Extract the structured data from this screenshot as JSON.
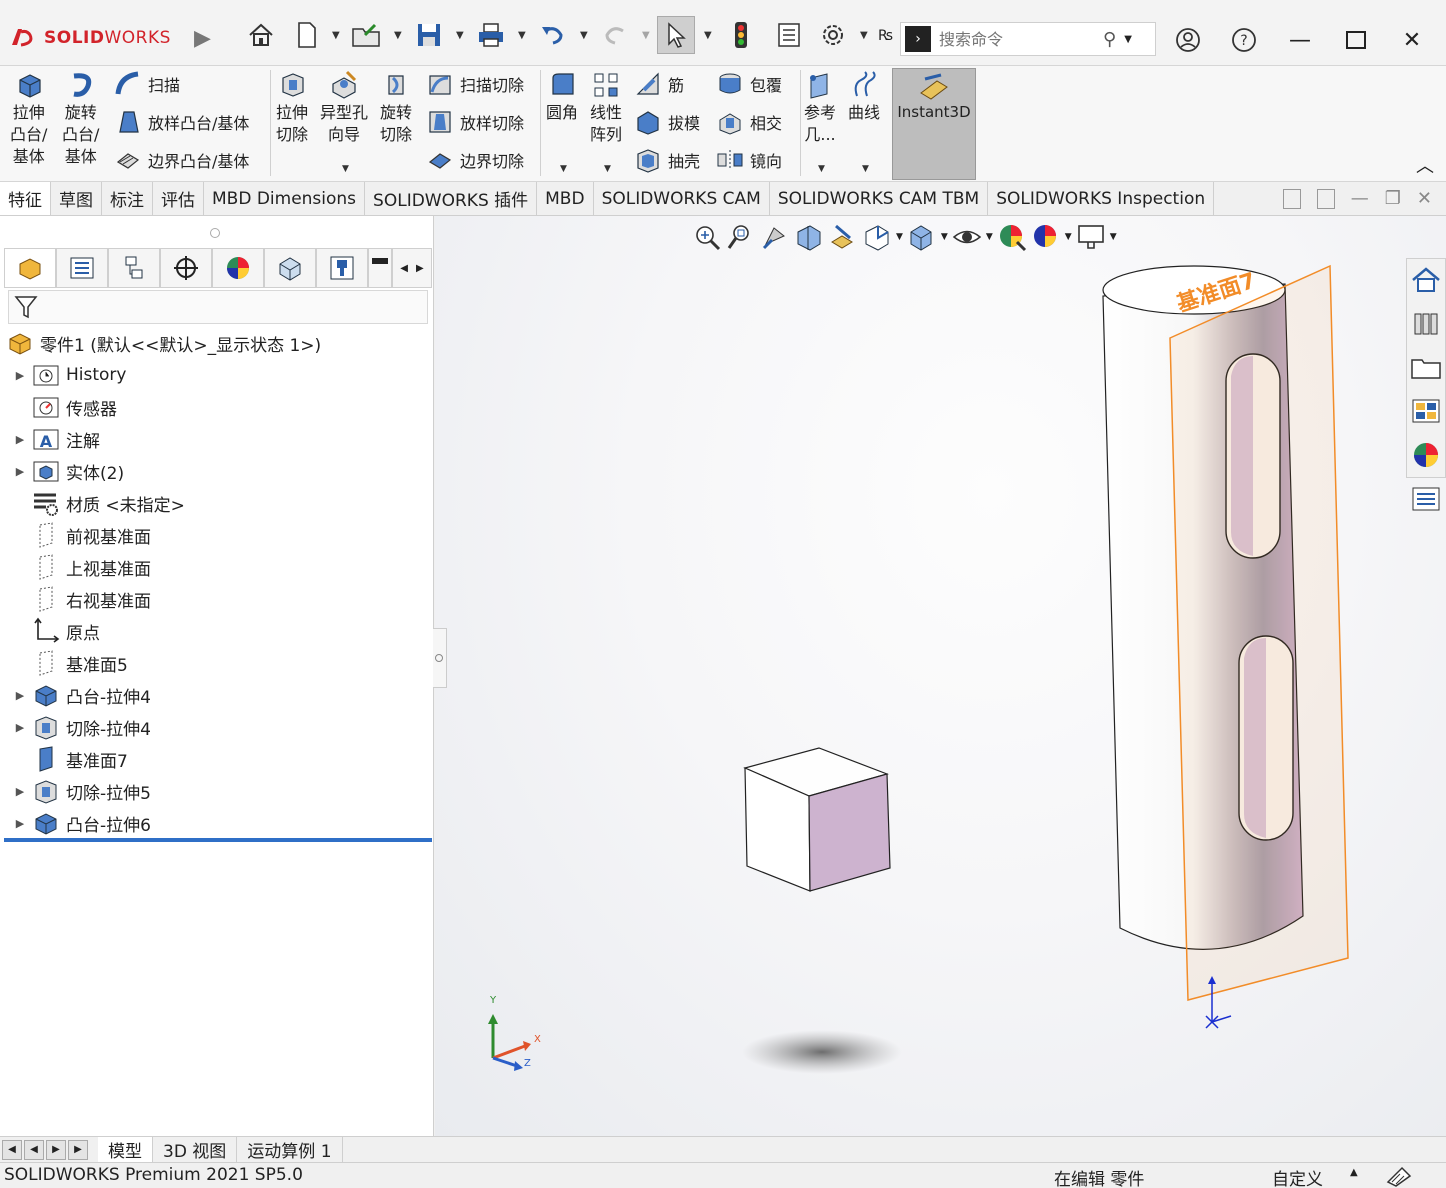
{
  "app": {
    "logo_text_a": "SOLID",
    "logo_text_b": "WORKS"
  },
  "search": {
    "placeholder": "搜索命令"
  },
  "ribbon": {
    "extrude_boss": [
      "拉伸",
      "凸台/",
      "基体"
    ],
    "revolve_boss": [
      "旋转",
      "凸台/",
      "基体"
    ],
    "sweep": "扫描",
    "loft_boss": "放样凸台/基体",
    "boundary_boss": "边界凸台/基体",
    "extrude_cut": [
      "拉伸",
      "切除"
    ],
    "hole_wizard": [
      "异型孔",
      "向导"
    ],
    "revolve_cut": [
      "旋转",
      "切除"
    ],
    "swept_cut": "扫描切除",
    "lofted_cut": "放样切除",
    "boundary_cut": "边界切除",
    "fillet": "圆角",
    "linear_pattern": [
      "线性",
      "阵列"
    ],
    "rib": "筋",
    "draft": "拔模",
    "shell": "抽壳",
    "wrap": "包覆",
    "intersect": "相交",
    "mirror": "镜向",
    "ref_geometry": [
      "参考",
      "几..."
    ],
    "curves": "曲线",
    "instant3d": "Instant3D"
  },
  "tabs": [
    "特征",
    "草图",
    "标注",
    "评估",
    "MBD Dimensions",
    "SOLIDWORKS 插件",
    "MBD",
    "SOLIDWORKS CAM",
    "SOLIDWORKS CAM TBM",
    "SOLIDWORKS Inspection"
  ],
  "tree": {
    "root": "零件1  (默认<<默认>_显示状态 1>)",
    "items": [
      {
        "label": "History"
      },
      {
        "label": "传感器"
      },
      {
        "label": "注解"
      },
      {
        "label": "实体(2)"
      },
      {
        "label": "材质 <未指定>"
      },
      {
        "label": "前视基准面"
      },
      {
        "label": "上视基准面"
      },
      {
        "label": "右视基准面"
      },
      {
        "label": "原点"
      },
      {
        "label": "基准面5"
      },
      {
        "label": "凸台-拉伸4"
      },
      {
        "label": "切除-拉伸4"
      },
      {
        "label": "基准面7"
      },
      {
        "label": "切除-拉伸5"
      },
      {
        "label": "凸台-拉伸6"
      }
    ]
  },
  "viewport": {
    "plane_label": "基准面7",
    "axis_x": "X",
    "axis_y": "Y",
    "axis_z": "Z"
  },
  "bottom_tabs": [
    "模型",
    "3D 视图",
    "运动算例 1"
  ],
  "status": {
    "product": "SOLIDWORKS Premium 2021 SP5.0",
    "mode": "在编辑 零件",
    "units": "自定义"
  },
  "colors": {
    "brand_red": "#d2232a",
    "plane_orange": "#f28c28",
    "face_pink": "#cdb3cf",
    "rollback_blue": "#2f6fc7"
  }
}
